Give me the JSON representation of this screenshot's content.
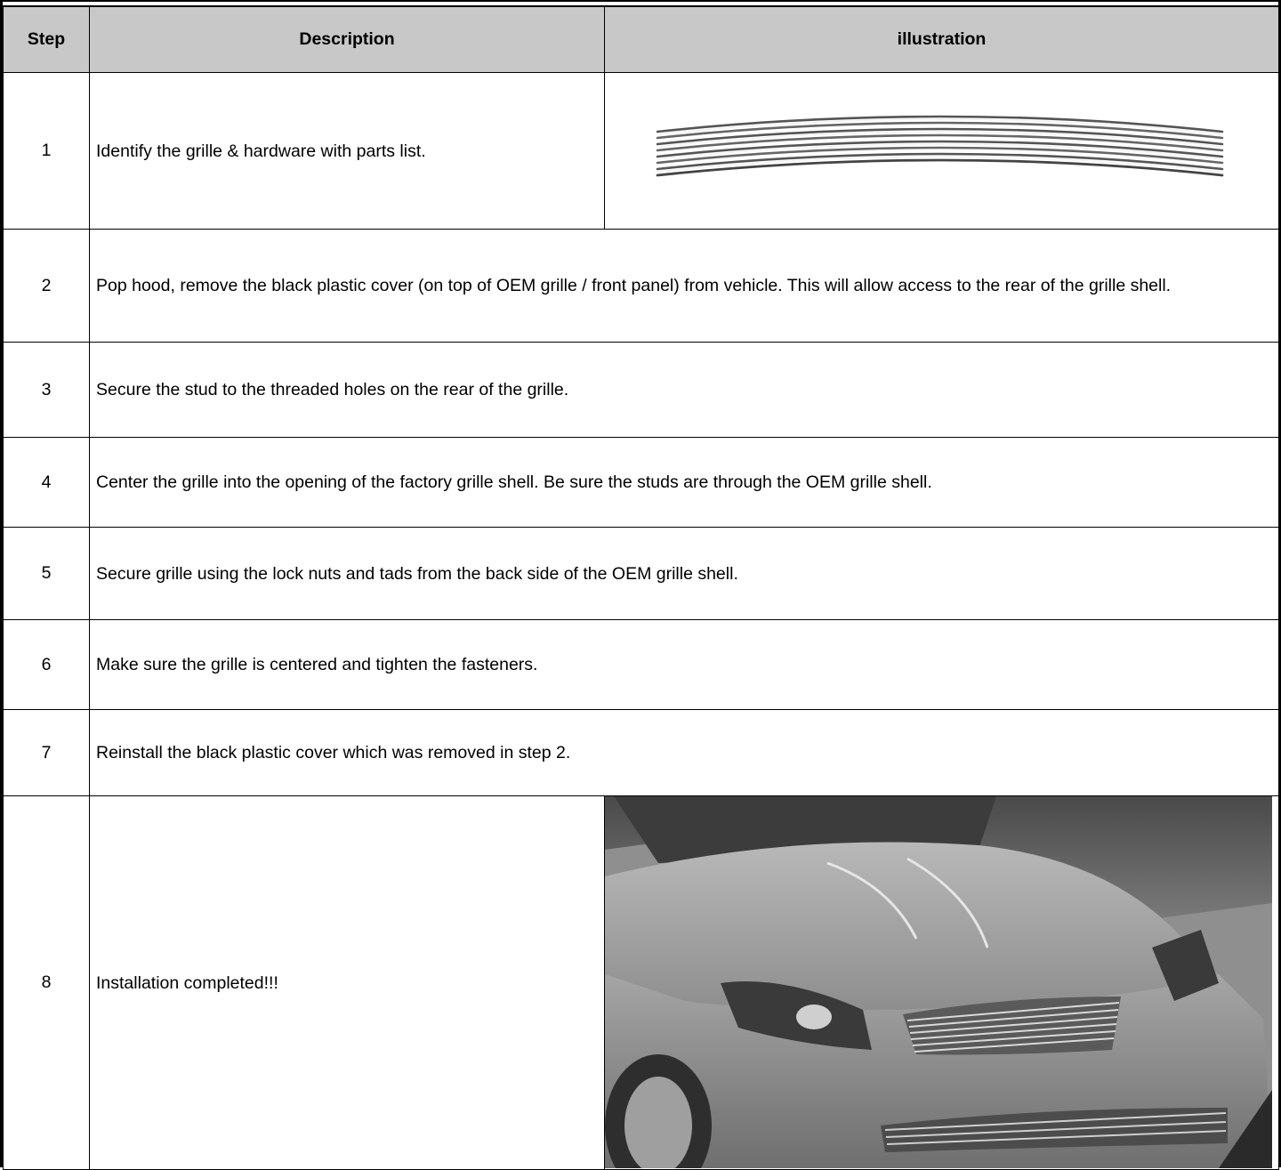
{
  "table": {
    "headers": {
      "step": "Step",
      "description": "Description",
      "illustration": "illustration"
    },
    "rows": [
      {
        "step": "1",
        "description": "Identify the grille & hardware with parts list."
      },
      {
        "step": "2",
        "description": "Pop hood, remove the black plastic cover (on top of OEM grille / front panel) from vehicle. This will allow access to the rear of the grille shell."
      },
      {
        "step": "3",
        "description": "Secure the stud to the threaded holes on the rear of the grille."
      },
      {
        "step": "4",
        "description": "Center the grille into the opening of the factory grille shell. Be sure the studs are through the OEM grille shell."
      },
      {
        "step": "5",
        "description": "Secure grille using the lock nuts and tads from the back side of the OEM grille shell."
      },
      {
        "step": "6",
        "description": "Make sure the grille is centered and tighten the fasteners."
      },
      {
        "step": "7",
        "description": "Reinstall the black plastic cover which was removed in step 2."
      },
      {
        "step": "8",
        "description": "Installation completed!!!"
      }
    ]
  },
  "images": {
    "grille": "billet-grille-photo",
    "car": "installed-grille-car-photo"
  }
}
